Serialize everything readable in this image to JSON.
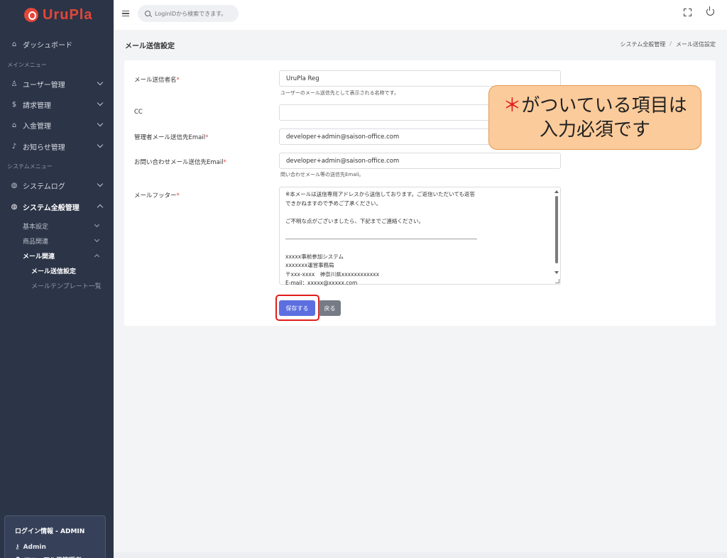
{
  "app": {
    "logo_text": "UruPla"
  },
  "search": {
    "placeholder": "LoginIDから検索できます。"
  },
  "sidebar": {
    "dashboard": "ダッシュボード",
    "section_main": "メインメニュー",
    "users": "ユーザー管理",
    "billing": "請求管理",
    "payment": "入金管理",
    "notices": "お知らせ管理",
    "section_system": "システムメニュー",
    "syslog": "システムログ",
    "system_general": "システム全般管理",
    "sub_basic": "基本設定",
    "sub_products": "商品関連",
    "sub_mail": "メール関連",
    "subsub_mail_settings": "メール送信設定",
    "subsub_mail_templates": "メールテンプレート一覧"
  },
  "login_info": {
    "title": "ログイン情報 - ADMIN",
    "user": "Admin",
    "role": "マニュアル用管理者"
  },
  "page": {
    "title": "メール送信設定",
    "breadcrumb": [
      "システム全般管理",
      "/",
      "メール送信設定"
    ]
  },
  "form": {
    "sender_name_label": "メール送信者名",
    "sender_name_value": "UruPla Reg",
    "sender_name_help": "ユーザーのメール送信先として表示される名称です。",
    "cc_label": "CC",
    "cc_value": "",
    "admin_email_label": "管理者メール送信先Email",
    "admin_email_value": "developer+admin@saison-office.com",
    "inquiry_email_label": "お問い合わせメール送信先Email",
    "inquiry_email_value": "developer+admin@saison-office.com",
    "inquiry_email_help": "問い合わせメール等の送信先Email。",
    "footer_label": "メールフッター",
    "required_mark": "*",
    "footer_lines": [
      "※本メールは送信専用アドレスから送信しております。ご返信いただいても返答",
      "できかねますので予めご了承ください。",
      "",
      "ご不明な点がございましたら、下記までご連絡ください。",
      "",
      "――――――――――――――――――――――――――――――――――――",
      "",
      "xxxxx事前参加システム",
      "xxxxxxx運営事務局",
      "〒xxx-xxxx　神奈川県xxxxxxxxxxxx",
      "E-mail：xxxxx@xxxxx.com"
    ],
    "save_label": "保存する",
    "back_label": "戻る"
  },
  "callout": {
    "star": "＊",
    "line1_rest": "がついている項目は",
    "line2": "入力必須です"
  },
  "colors": {
    "sidebar_bg": "#2c3547",
    "primary_button": "#5c6ee0",
    "secondary_button": "#767b85",
    "required": "#e34b4b",
    "callout_bg": "#fbcb9b",
    "highlight_border": "#e01b1b"
  }
}
